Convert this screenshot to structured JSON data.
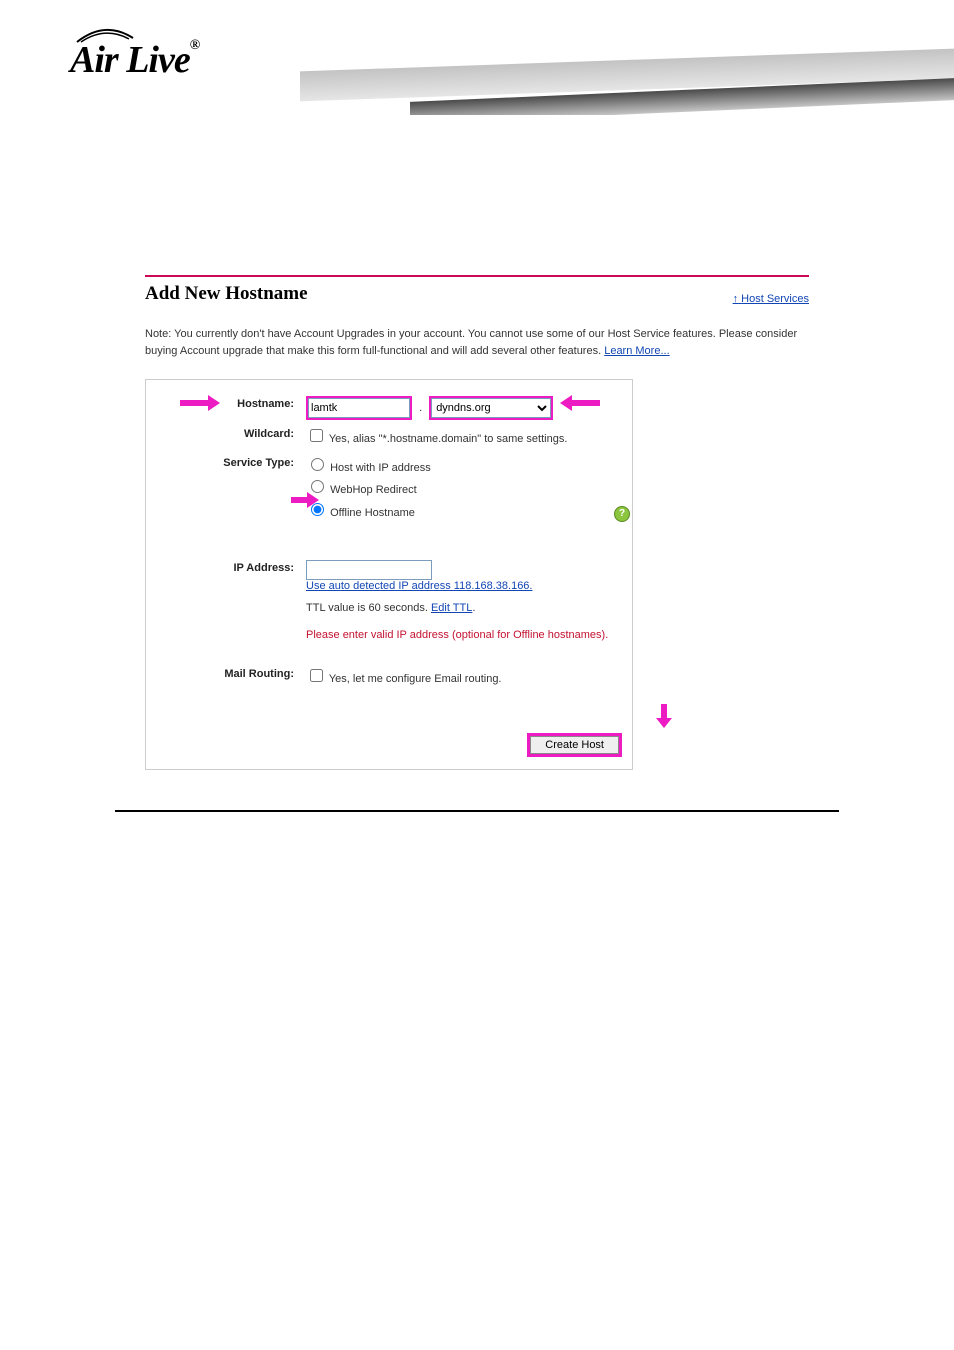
{
  "brand": "Air Live",
  "page": {
    "title": "Add New Hostname",
    "host_services_link": "Host Services"
  },
  "note": {
    "text": "Note: You currently don't have Account Upgrades in your account. You cannot use some of our Host Service features. Please consider buying Account upgrade that make this form full-functional and will add several other features. ",
    "learn_more": "Learn More..."
  },
  "form": {
    "hostname_label": "Hostname:",
    "hostname_value": "lamtk",
    "domain_value": "dyndns.org",
    "wildcard_label": "Wildcard:",
    "wildcard_text": " Yes, alias \"*.hostname.domain\" to same settings.",
    "service_type_label": "Service Type:",
    "service_options": {
      "host_ip": "Host with IP address",
      "webhop": "WebHop Redirect",
      "offline": "Offline Hostname"
    },
    "service_selected": "offline",
    "ip_label": "IP Address:",
    "ip_value": "",
    "auto_ip_link": "Use auto detected IP address 118.168.38.166.",
    "ttl_prefix": "TTL value is 60 seconds. ",
    "ttl_link": "Edit TTL",
    "ttl_suffix": ".",
    "ip_warning": "Please enter valid IP address (optional for Offline hostnames).",
    "mail_label": "Mail Routing:",
    "mail_text": " Yes, let me configure Email routing.",
    "create_button": "Create Host"
  }
}
